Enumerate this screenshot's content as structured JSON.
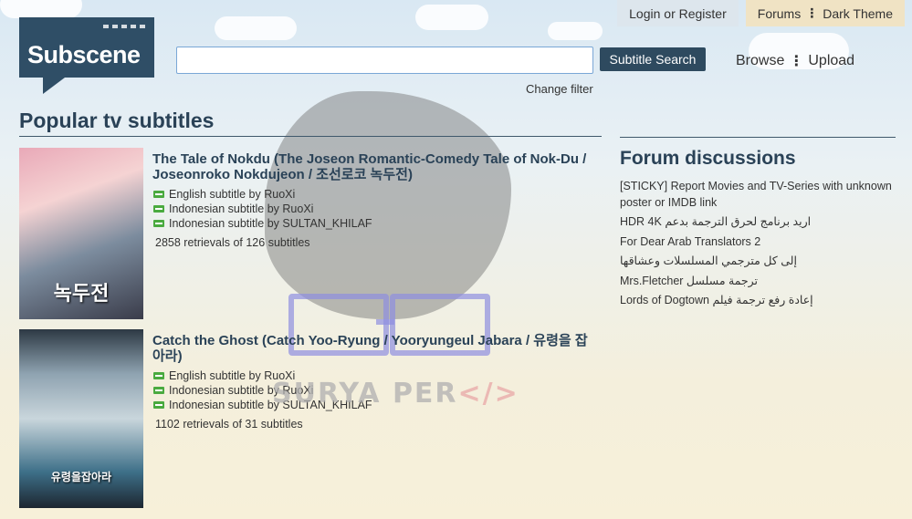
{
  "topnav": {
    "login": "Login or Register",
    "forums": "Forums",
    "dark_theme": "Dark Theme"
  },
  "logo": {
    "text": "Subscene"
  },
  "search": {
    "value": "",
    "button": "Subtitle Search",
    "change_filter": "Change filter"
  },
  "nav": {
    "browse": "Browse",
    "upload": "Upload"
  },
  "popular": {
    "title": "Popular tv subtitles",
    "items": [
      {
        "title": "The Tale of Nokdu (The Joseon Romantic-Comedy Tale of Nok-Du / Joseonroko Nokdujeon / 조선로코 녹두전)",
        "poster_text": "녹두전",
        "subtitles": [
          "English subtitle by RuoXi",
          "Indonesian subtitle by RuoXi",
          "Indonesian subtitle by SULTAN_KHILAF"
        ],
        "retrievals": "2858 retrievals of 126 subtitles"
      },
      {
        "title": "Catch the Ghost (Catch Yoo-Ryung / Yooryungeul Jabara / 유령을 잡아라)",
        "poster_text": "유령을잡아라",
        "subtitles": [
          "English subtitle by RuoXi",
          "Indonesian subtitle by RuoXi",
          "Indonesian subtitle by SULTAN_KHILAF"
        ],
        "retrievals": "1102 retrievals of 31 subtitles"
      }
    ]
  },
  "forum": {
    "title": "Forum discussions",
    "items": [
      "[STICKY] Report Movies and TV-Series with unknown poster or IMDB link",
      "اريد برنامج لحرق الترجمة بدعم HDR 4K",
      "For Dear Arab Translators 2",
      "إلى كل مترجمي المسلسلات وعشاقها",
      "ترجمة مسلسل Mrs.Fletcher",
      "إعادة رفع ترجمة فيلم Lords of Dogtown"
    ]
  },
  "watermark": {
    "name": "SURYA PER",
    "code": "</>"
  }
}
